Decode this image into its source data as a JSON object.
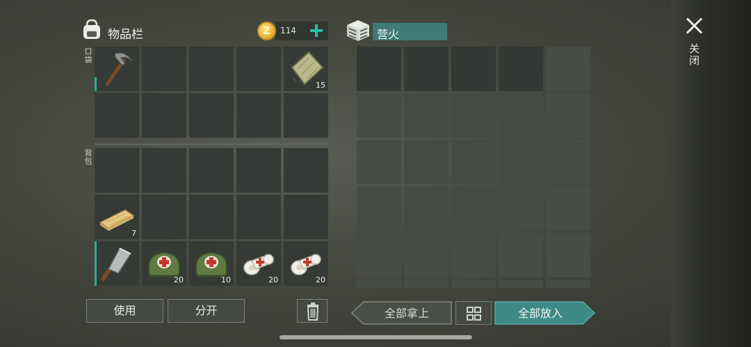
{
  "inventory": {
    "title": "物品栏",
    "coins": "114",
    "pocket_label": "口袋",
    "backpack_label": "背包",
    "pocket_slots": [
      {
        "item": "pickaxe",
        "qty": ""
      },
      {
        "item": "",
        "qty": ""
      },
      {
        "item": "",
        "qty": ""
      },
      {
        "item": "",
        "qty": ""
      },
      {
        "item": "cloth",
        "qty": "15"
      },
      {
        "item": "",
        "qty": ""
      },
      {
        "item": "",
        "qty": ""
      },
      {
        "item": "",
        "qty": ""
      },
      {
        "item": "",
        "qty": ""
      },
      {
        "item": "",
        "qty": ""
      }
    ],
    "backpack_slots": [
      {
        "item": "",
        "qty": ""
      },
      {
        "item": "",
        "qty": ""
      },
      {
        "item": "",
        "qty": ""
      },
      {
        "item": "",
        "qty": ""
      },
      {
        "item": "",
        "qty": ""
      },
      {
        "item": "plank",
        "qty": "7"
      },
      {
        "item": "",
        "qty": ""
      },
      {
        "item": "",
        "qty": ""
      },
      {
        "item": "",
        "qty": ""
      },
      {
        "item": "",
        "qty": ""
      },
      {
        "item": "cleaver",
        "qty": ""
      },
      {
        "item": "medkit",
        "qty": "20"
      },
      {
        "item": "medkit",
        "qty": "10"
      },
      {
        "item": "bandage",
        "qty": "20"
      },
      {
        "item": "bandage",
        "qty": "20"
      }
    ]
  },
  "campfire": {
    "title": "营火"
  },
  "close_label": "关闭",
  "buttons": {
    "use": "使用",
    "split": "分开",
    "take_all": "全部拿上",
    "put_all": "全部放入"
  },
  "colors": {
    "accent": "#2fa89a",
    "title_bar": "#3f7b78",
    "coin": "#e7b23a"
  }
}
